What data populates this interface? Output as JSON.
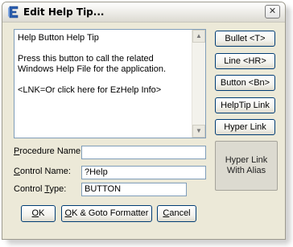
{
  "window": {
    "title": "Edit Help Tip...",
    "close_glyph": "✕"
  },
  "editor": {
    "text": "Help Button Help Tip\n\nPress this button to call the related Windows Help File for the application.\n\n<LNK=Or click here for EzHelp Info>"
  },
  "side_buttons": {
    "bullet": "Bullet <T>",
    "line": "Line <HR>",
    "button": "Button <Bn>",
    "helptip_link": "HelpTip Link",
    "hyper_link": "Hyper Link",
    "hyper_link_alias_line1": "Hyper Link",
    "hyper_link_alias_line2": "With Alias"
  },
  "fields": {
    "procedure_name": {
      "label_accel": "P",
      "label_rest": "rocedure Name:",
      "value": ""
    },
    "control_name": {
      "label_accel": "C",
      "label_rest": "ontrol Name:",
      "value": "?Help"
    },
    "control_type": {
      "label_pre": "Control ",
      "label_accel": "T",
      "label_post": "ype:",
      "value": "BUTTON"
    }
  },
  "bottom_buttons": {
    "ok_accel": "O",
    "ok_rest": "K",
    "ok_goto_accel": "O",
    "ok_goto_rest": "K & Goto Formatter",
    "cancel_accel": "C",
    "cancel_rest": "ancel"
  },
  "icons": {
    "app": "ezhelp-app-icon",
    "close": "close-icon",
    "scroll_up": "scroll-up-arrow-icon",
    "scroll_down": "scroll-down-arrow-icon"
  },
  "colors": {
    "dialog_bg": "#ece9d8",
    "button_border": "#003c74",
    "field_border": "#7f9db9",
    "app_icon": "#2a5fb0"
  }
}
